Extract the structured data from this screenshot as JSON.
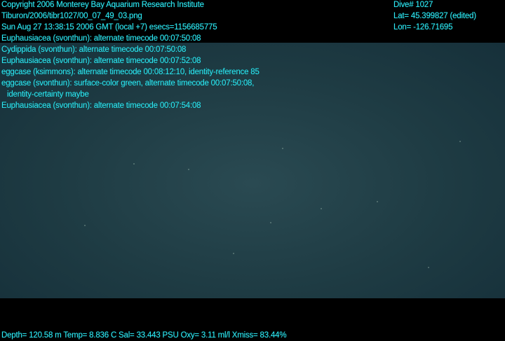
{
  "overlay": {
    "header_left": [
      "Copyright 2006 Monterey Bay Aquarium Research Institute",
      "Tiburon/2006/tibr1027/00_07_49_03.png",
      "Sun Aug 27 13:38:15 2006 GMT (local +7)  esecs=1156685775"
    ],
    "header_right": {
      "dive": "Dive# 1027",
      "lat": "Lat= 45.399827 (edited)",
      "lon": "Lon= -126.71695"
    },
    "annotations": [
      "Euphausiacea (svonthun): alternate timecode 00:07:50:08",
      "Cydippida (svonthun): alternate timecode 00:07:50:08",
      "Euphausiacea (svonthun): alternate timecode 00:07:52:08",
      "eggcase (ksimmons): alternate timecode 00:08:12:10, identity-reference 85",
      "eggcase (svonthun): surface-color green, alternate timecode 00:07:50:08,",
      "identity-certainty maybe",
      "Euphausiacea (svonthun): alternate timecode 00:07:54:08"
    ],
    "sensor_readout": "Depth= 120.58 m  Temp= 8.836 C  Sal= 33.443 PSU  Oxy= 3.11 ml/l  Xmiss= 83.44%"
  }
}
